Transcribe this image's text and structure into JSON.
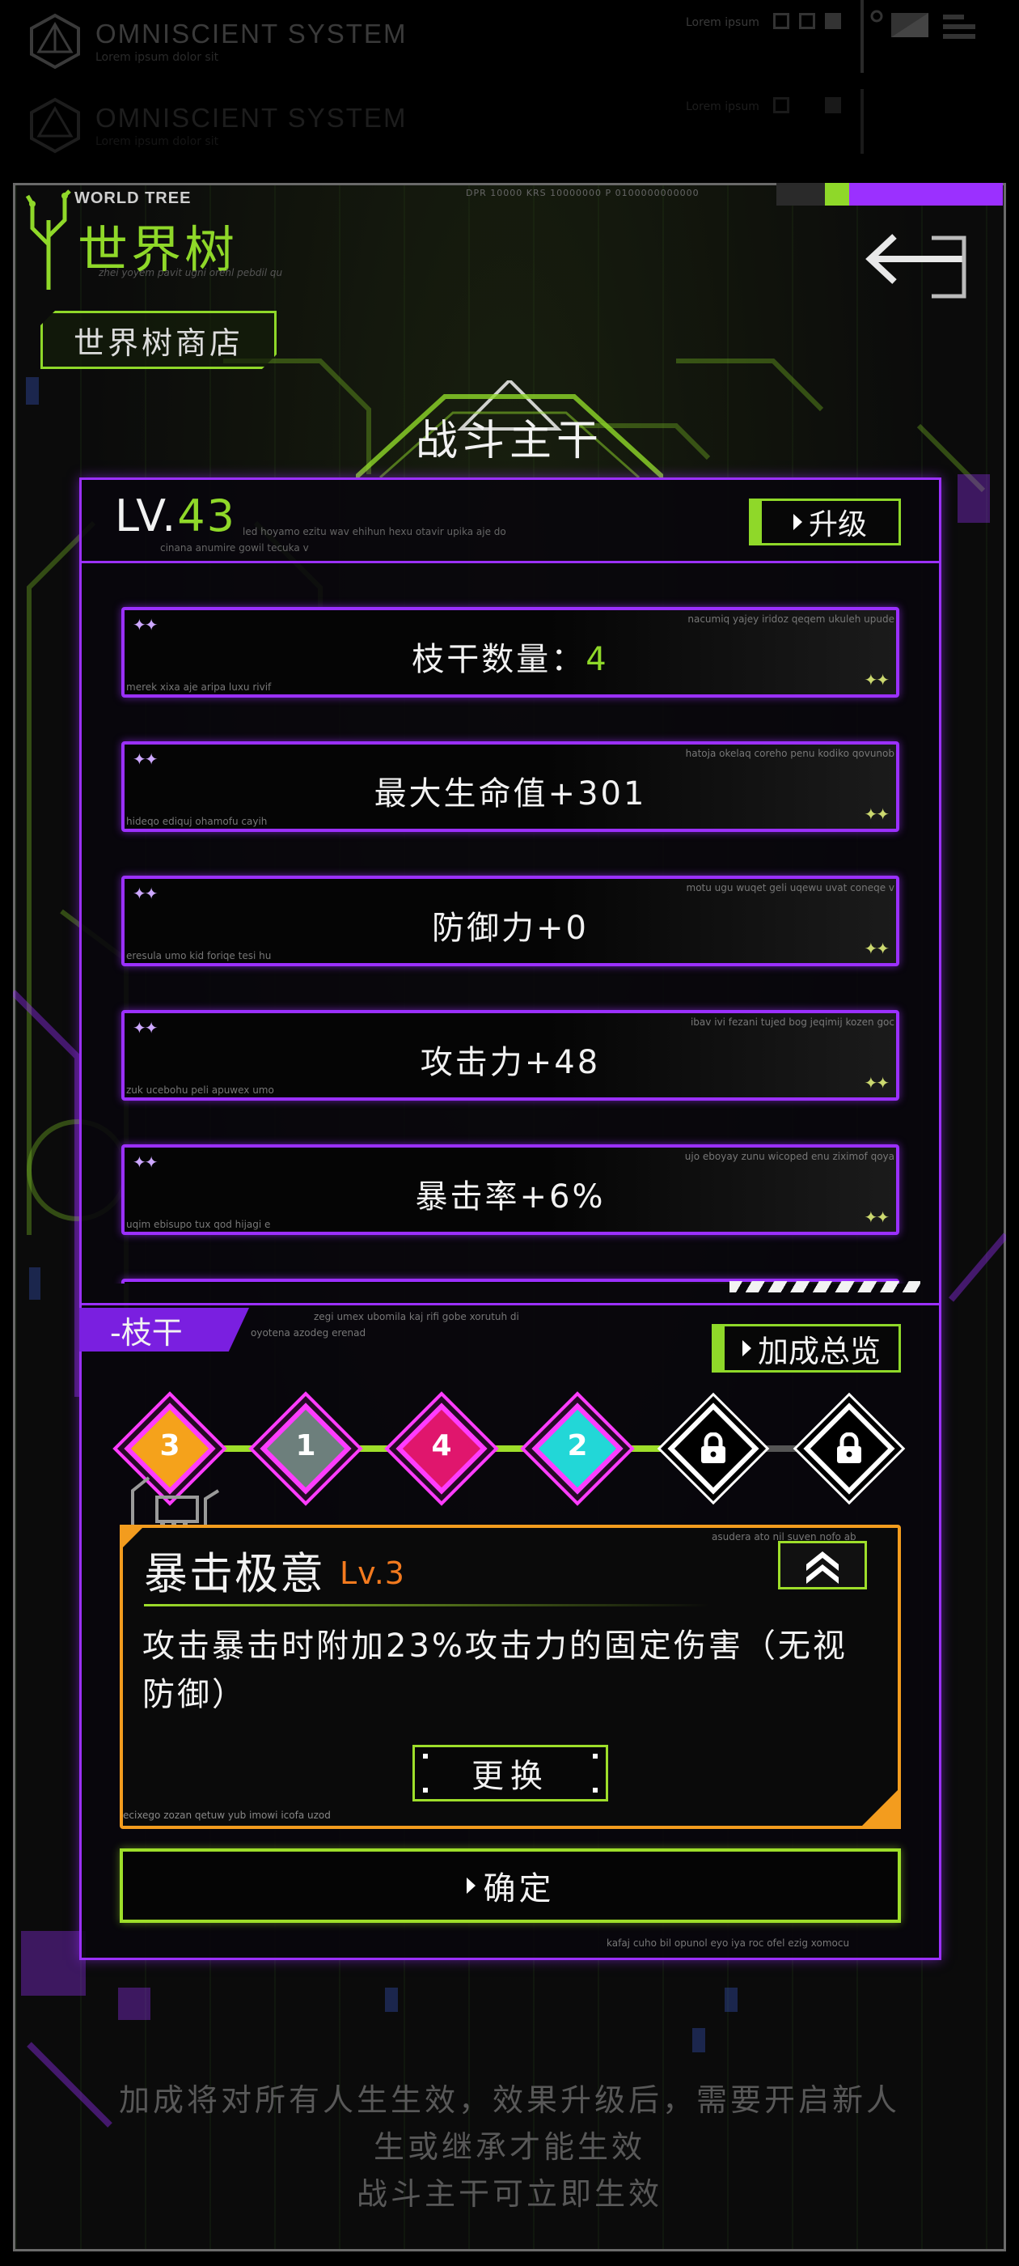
{
  "system": {
    "title": "OMNISCIENT SYSTEM",
    "subtitle": "Lorem ipsum dolor sit",
    "title2": "OMNISCIENT SYSTEM",
    "subtitle2": "Lorem ipsum dolor sit",
    "lorem_small": "Lorem ipsum",
    "lorem_small2": "Lorem ipsum"
  },
  "header": {
    "world_tree_en": "WORLD TREE",
    "world_tree_cn": "世界树",
    "world_tree_tiny": "zhei yoyem pavit ugni orehl pebdil qu",
    "shop_label": "世界树商店",
    "top_code": "DPR 10000 KRS 10000000 P 0100000000000"
  },
  "panel": {
    "title": "战斗主干",
    "lv_prefix": "LV.",
    "lv_value": "43",
    "lv_tiny1": "led hoyamo ezitu wav ehihun hexu otavir upika aje do",
    "lv_tiny2": "cinana anumire gowil tecuka v",
    "upgrade_label": "升级"
  },
  "stats": [
    {
      "label": "枝干数量：",
      "value": "4",
      "tiny_tr": "nacumiq yajey iridoz qeqem ukuleh upude",
      "tiny_bl": "merek xixa aje aripa luxu rivif"
    },
    {
      "label": "最大生命值+301",
      "value": "",
      "tiny_tr": "hatoja okelaq coreho penu kodiko qovunob",
      "tiny_bl": "hideqo ediquj ohamofu cayih"
    },
    {
      "label": "防御力+0",
      "value": "",
      "tiny_tr": "motu ugu wuqet geli uqewu uvat coneqe v",
      "tiny_bl": "eresula umo kid foriqe tesi hu"
    },
    {
      "label": "攻击力+48",
      "value": "",
      "tiny_tr": "ibav ivi fezani tujed bog jeqimij kozen goc",
      "tiny_bl": "zuk ucebohu peli apuwex umo"
    },
    {
      "label": "暴击率+6%",
      "value": "",
      "tiny_tr": "ujo eboyay zunu wicoped enu ziximof qoya",
      "tiny_bl": "uqim ebisupo tux qod hijagi e"
    }
  ],
  "branch": {
    "tag": "-枝干",
    "tiny1": "zegi umex ubomila kaj rifi gobe xorutuh di",
    "tiny2": "oyotena azodeg erenad",
    "bonus_label": "加成总览",
    "nodes": [
      {
        "label": "3",
        "color": "#f5a21b",
        "locked": false
      },
      {
        "label": "1",
        "color": "#6d7f7c",
        "locked": false
      },
      {
        "label": "4",
        "color": "#e0166d",
        "locked": false
      },
      {
        "label": "2",
        "color": "#22d7d7",
        "locked": false
      },
      {
        "label": "",
        "color": "#000000",
        "locked": true
      },
      {
        "label": "",
        "color": "#000000",
        "locked": true
      }
    ]
  },
  "skill": {
    "name": "暴击极意",
    "level": "Lv.3",
    "tiny": "asudera ato nil suven nofo ab",
    "description": "攻击暴击时附加23%攻击力的固定伤害（无视防御）",
    "tiny2": "ecixego zozan qetuw yub imowi icofa uzod",
    "replace_label": "更换"
  },
  "confirm": {
    "label": "确定",
    "tiny": "kafaj cuho bil opunol eyo iya roc ofel ezig xomocu"
  },
  "footer": {
    "line1": "加成将对所有人生生效，效果升级后，需要开启新人",
    "line2": "生或继承才能生效",
    "line3": "战斗主干可立即生效"
  },
  "colors": {
    "accent_green": "#8fd829",
    "accent_purple": "#9b30ff",
    "accent_orange": "#f39c1e"
  }
}
